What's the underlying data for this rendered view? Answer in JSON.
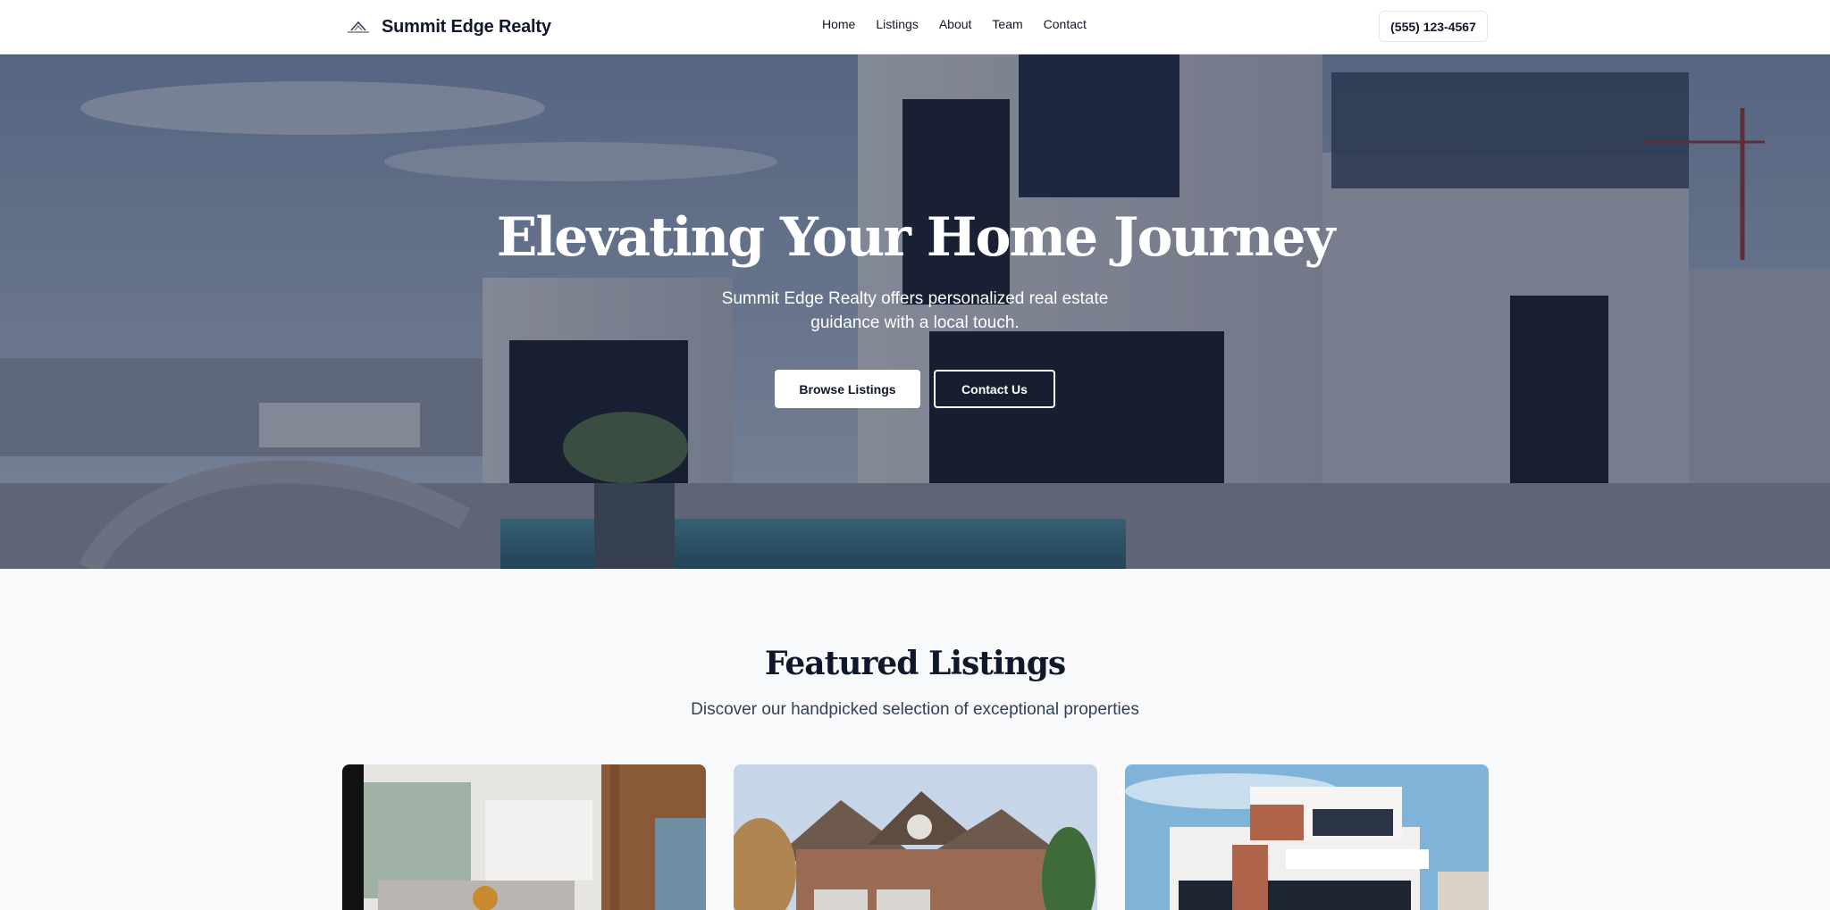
{
  "brand": {
    "name": "Summit Edge Realty",
    "logo_icon": "mountain-logo-icon"
  },
  "nav": {
    "items": [
      "Home",
      "Listings",
      "About",
      "Team",
      "Contact"
    ]
  },
  "header": {
    "phone": "(555) 123-4567"
  },
  "hero": {
    "title": "Elevating Your Home Journey",
    "subtitle": "Summit Edge Realty offers personalized real estate guidance with a local touch.",
    "primary_button": "Browse Listings",
    "secondary_button": "Contact Us"
  },
  "featured": {
    "title": "Featured Listings",
    "subtitle": "Discover our handpicked selection of exceptional properties",
    "listings": [
      {
        "image": "modern-interior-living-room"
      },
      {
        "image": "brick-suburban-house"
      },
      {
        "image": "modern-villa-exterior"
      }
    ]
  },
  "colors": {
    "text_dark": "#0f172a",
    "muted": "#334155",
    "section_bg": "#f8f9fb",
    "white": "#ffffff"
  }
}
